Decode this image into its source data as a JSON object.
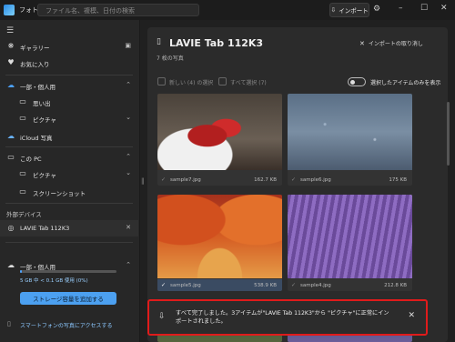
{
  "app": {
    "title": "フォト"
  },
  "search": {
    "placeholder": "ファイル名、複模、日付の検索"
  },
  "toolbar": {
    "import_label": "インポート"
  },
  "sidebar": {
    "items": [
      {
        "label": "ギャラリー"
      },
      {
        "label": "お気に入り"
      },
      {
        "label": "一部・個人用"
      },
      {
        "label": "思い出"
      },
      {
        "label": "ピクチャ"
      },
      {
        "label": "iCloud 写真"
      },
      {
        "label": "この PC"
      },
      {
        "label": "ピクチャ"
      },
      {
        "label": "スクリーンショット"
      }
    ],
    "external_label": "外部デバイス",
    "device_label": "LAVIE Tab 112K3",
    "storage": {
      "account": "一部・個人用",
      "usage_text": "5 GB 中 < 0.1 GB 使用 (0%)",
      "usage_fraction": 0.02,
      "add_button": "ストレージ容量を追加する",
      "phone_link": "スマートフォンの写真にアクセスする"
    }
  },
  "main": {
    "device_title": "LAVIE Tab 112K3",
    "photo_count": "7 枚の写真",
    "cancel_import": "インポートの取り消し",
    "select_new": "新しい (4) の選択",
    "select_all": "すべて選択 (7)",
    "show_selected": "選択したアイテムのみを表示",
    "photos": [
      {
        "name": "sample7.jpg",
        "size": "162.7 KB"
      },
      {
        "name": "sample6.jpg",
        "size": "175 KB"
      },
      {
        "name": "sample5.jpg",
        "size": "538.9 KB"
      },
      {
        "name": "sample4.jpg",
        "size": "212.8 KB"
      }
    ]
  },
  "toast": {
    "message": "すべて完了しました。3アイテムが\"LAVIE Tab 112K3\"から \"ピクチャ\"に正常にインポートされました。"
  }
}
